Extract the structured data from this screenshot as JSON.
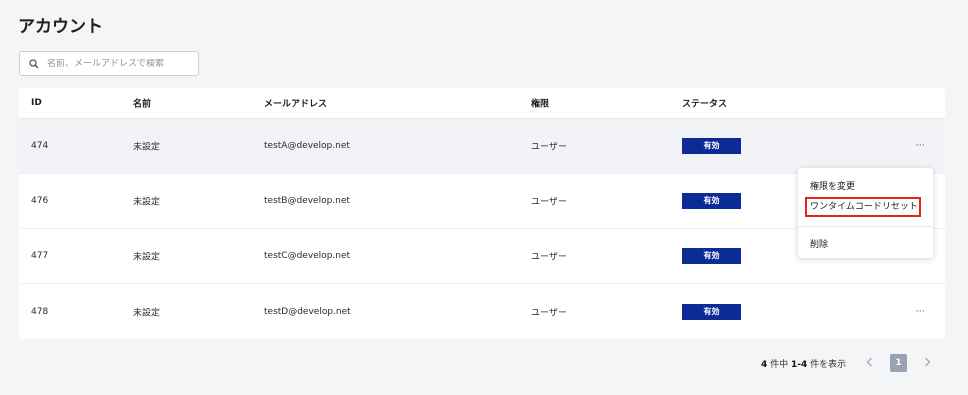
{
  "page": {
    "title": "アカウント"
  },
  "search": {
    "placeholder": "名前、メールアドレスで検索",
    "value": ""
  },
  "table": {
    "headers": {
      "id": "ID",
      "name": "名前",
      "email": "メールアドレス",
      "role": "権限",
      "status": "ステータス"
    },
    "rows": [
      {
        "id": "474",
        "name": "未設定",
        "email": "testA@develop.net",
        "role": "ユーザー",
        "status": "有効",
        "more": "···"
      },
      {
        "id": "476",
        "name": "未設定",
        "email": "testB@develop.net",
        "role": "ユーザー",
        "status": "有効",
        "more": ""
      },
      {
        "id": "477",
        "name": "未設定",
        "email": "testC@develop.net",
        "role": "ユーザー",
        "status": "有効",
        "more": ""
      },
      {
        "id": "478",
        "name": "未設定",
        "email": "testD@develop.net",
        "role": "ユーザー",
        "status": "有効",
        "more": "···"
      }
    ]
  },
  "context_menu": {
    "items": [
      "権限を変更",
      "ワンタイムコードリセット",
      "削除"
    ]
  },
  "pagination": {
    "total": "4",
    "total_suffix": "件中",
    "range": "1-4",
    "range_suffix": "件を表示",
    "current_page": "1"
  },
  "colors": {
    "status_badge": "#0d2b97",
    "highlight_border": "#e0251d",
    "page_active": "#99a1b3"
  }
}
